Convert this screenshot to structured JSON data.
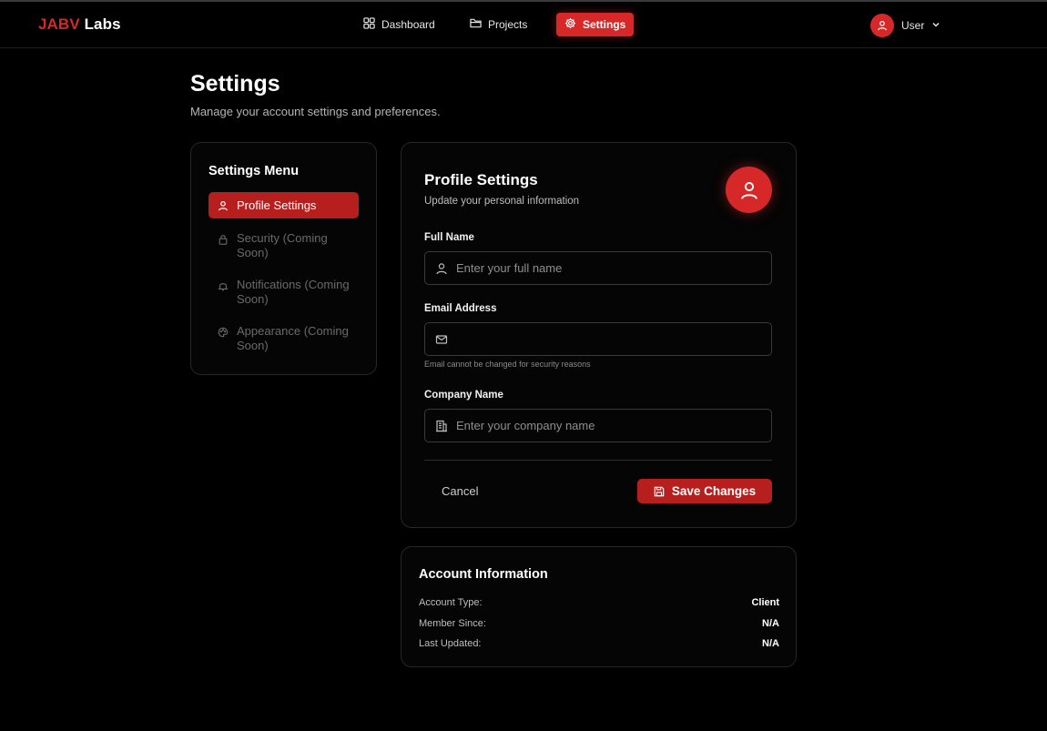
{
  "brand": {
    "part1": "JABV",
    "part2": "Labs"
  },
  "nav": {
    "items": [
      {
        "label": "Dashboard",
        "icon": "grid-icon"
      },
      {
        "label": "Projects",
        "icon": "folder-icon"
      },
      {
        "label": "Settings",
        "icon": "gear-icon",
        "active": true
      }
    ],
    "user_label": "User"
  },
  "page": {
    "title": "Settings",
    "subtitle": "Manage your account settings and preferences."
  },
  "menu": {
    "title": "Settings Menu",
    "items": [
      {
        "label": "Profile Settings",
        "icon": "user-icon",
        "active": true
      },
      {
        "label": "Security (Coming Soon)",
        "icon": "lock-icon",
        "disabled": true
      },
      {
        "label": "Notifications (Coming Soon)",
        "icon": "bell-icon",
        "disabled": true
      },
      {
        "label": "Appearance (Coming Soon)",
        "icon": "palette-icon",
        "disabled": true
      }
    ]
  },
  "profile": {
    "title": "Profile Settings",
    "subtitle": "Update your personal information",
    "full_name": {
      "label": "Full Name",
      "placeholder": "Enter your full name",
      "value": ""
    },
    "email": {
      "label": "Email Address",
      "placeholder": "",
      "value": "",
      "note": "Email cannot be changed for security reasons"
    },
    "company": {
      "label": "Company Name",
      "placeholder": "Enter your company name",
      "value": ""
    },
    "cancel_label": "Cancel",
    "save_label": "Save Changes"
  },
  "account": {
    "title": "Account Information",
    "rows": [
      {
        "key": "Account Type:",
        "value": "Client"
      },
      {
        "key": "Member Since:",
        "value": "N/A"
      },
      {
        "key": "Last Updated:",
        "value": "N/A"
      }
    ]
  },
  "colors": {
    "accent": "#d62828",
    "accent_dark": "#b71f1f",
    "background": "#000000"
  }
}
